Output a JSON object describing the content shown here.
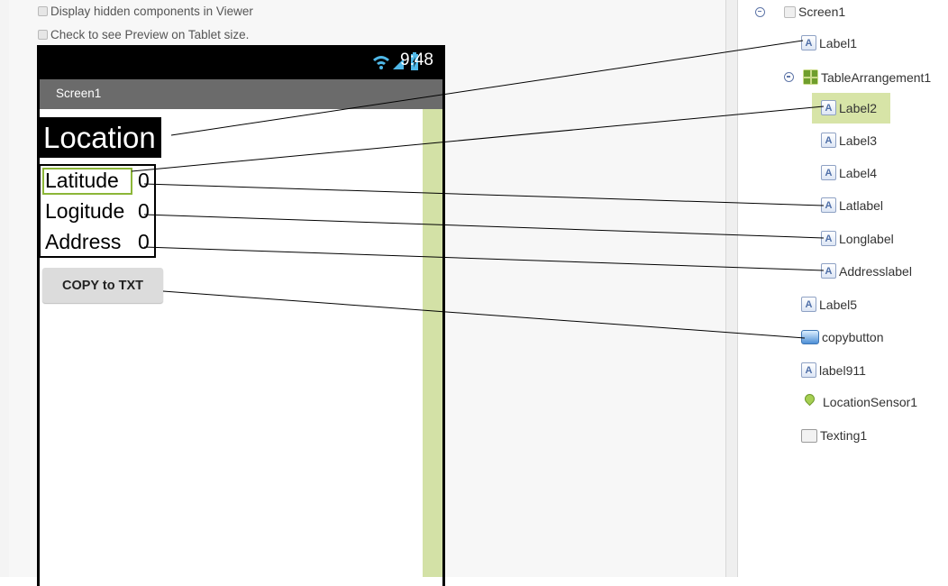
{
  "viewer": {
    "hidden_components_label": "Display hidden components in Viewer",
    "tablet_preview_label": "Check to see Preview on Tablet size."
  },
  "phone": {
    "status_time": "9:48",
    "screen_title": "Screen1",
    "label1_text": "Location",
    "rows": [
      {
        "label": "Latitude",
        "value": "0"
      },
      {
        "label": "Logitude",
        "value": "0"
      },
      {
        "label": "Address",
        "value": "0"
      }
    ],
    "copy_button_label": "COPY to TXT"
  },
  "tree": {
    "items": [
      {
        "label": "Screen1",
        "icon": "screen-icon"
      },
      {
        "label": "Label1",
        "icon": "label-icon"
      },
      {
        "label": "TableArrangement1",
        "icon": "table-arrangement-icon"
      },
      {
        "label": "Label2",
        "icon": "label-icon",
        "selected": true
      },
      {
        "label": "Label3",
        "icon": "label-icon"
      },
      {
        "label": "Label4",
        "icon": "label-icon"
      },
      {
        "label": "Latlabel",
        "icon": "label-icon"
      },
      {
        "label": "Longlabel",
        "icon": "label-icon"
      },
      {
        "label": "Addresslabel",
        "icon": "label-icon"
      },
      {
        "label": "Label5",
        "icon": "label-icon"
      },
      {
        "label": "copybutton",
        "icon": "button-icon"
      },
      {
        "label": "label911",
        "icon": "label-icon"
      },
      {
        "label": "LocationSensor1",
        "icon": "location-sensor-icon"
      },
      {
        "label": "Texting1",
        "icon": "texting-icon"
      }
    ]
  },
  "colors": {
    "selection_green": "#8cb638",
    "selection_bg": "#d7e4a7",
    "scroll_strip": "#d3e1a6"
  }
}
